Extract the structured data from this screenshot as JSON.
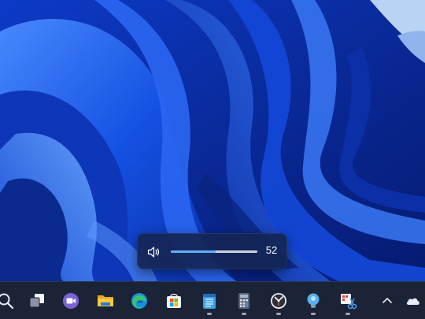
{
  "volume": {
    "value_label": "52",
    "level": 0.52
  },
  "taskbar": {
    "items": [
      {
        "name": "search",
        "icon": "search-icon",
        "running": false
      },
      {
        "name": "task-view",
        "icon": "task-view-icon",
        "running": false
      },
      {
        "name": "teams-chat",
        "icon": "video-chat-icon",
        "running": false
      },
      {
        "name": "file-explorer",
        "icon": "folder-icon",
        "running": false
      },
      {
        "name": "edge",
        "icon": "edge-browser-icon",
        "running": false
      },
      {
        "name": "store",
        "icon": "store-bag-icon",
        "running": false
      },
      {
        "name": "notepad",
        "icon": "notepad-icon",
        "running": true
      },
      {
        "name": "calculator",
        "icon": "calculator-icon",
        "running": true
      },
      {
        "name": "clock",
        "icon": "clock-icon",
        "running": true
      },
      {
        "name": "tips",
        "icon": "lightbulb-icon",
        "running": true
      },
      {
        "name": "snipping-tool",
        "icon": "scissors-icon",
        "running": true
      }
    ],
    "tray": [
      {
        "name": "hidden-icons",
        "icon": "chevron-up-icon"
      },
      {
        "name": "onedrive",
        "icon": "cloud-icon"
      }
    ]
  }
}
